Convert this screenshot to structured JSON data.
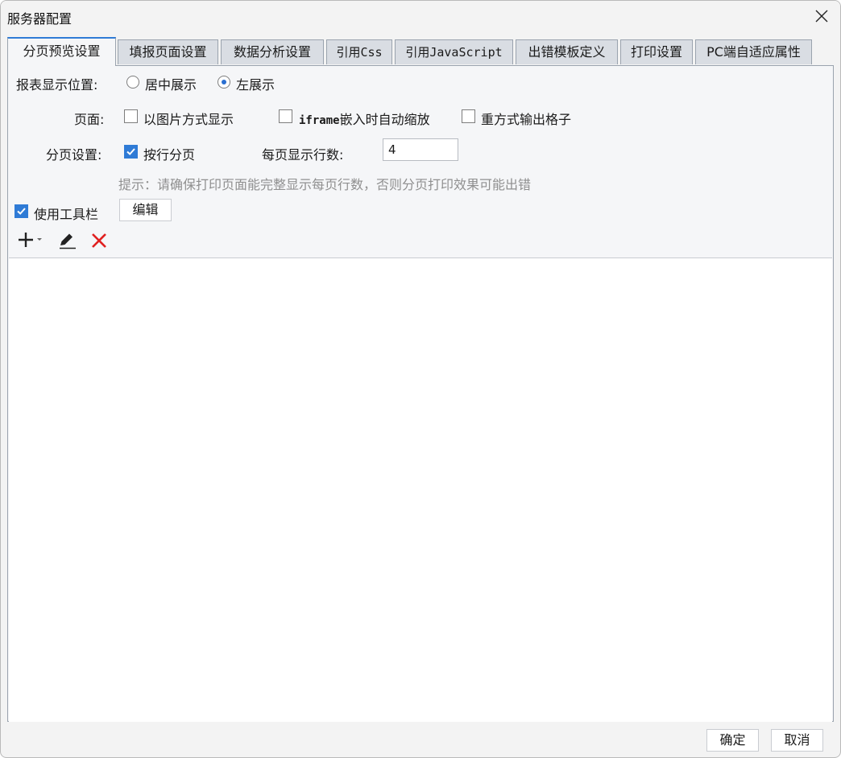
{
  "window": {
    "title": "服务器配置"
  },
  "tabs": [
    {
      "label": "分页预览设置",
      "active": true
    },
    {
      "label": "填报页面设置"
    },
    {
      "label": "数据分析设置"
    },
    {
      "label": "引用Css"
    },
    {
      "label": "引用JavaScript"
    },
    {
      "label": "出错模板定义"
    },
    {
      "label": "打印设置"
    },
    {
      "label": "PC端自适应属性"
    }
  ],
  "report_position": {
    "label": "报表显示位置:",
    "options": [
      {
        "label": "居中展示",
        "checked": false
      },
      {
        "label": "左展示",
        "checked": true
      }
    ]
  },
  "page": {
    "label": "页面:",
    "options": [
      {
        "label": "以图片方式显示",
        "checked": false
      },
      {
        "label_prefix": "iframe",
        "label_suffix": "嵌入时自动缩放",
        "checked": false
      },
      {
        "label": "重方式输出格子",
        "checked": false
      }
    ]
  },
  "pagination": {
    "label": "分页设置:",
    "by_row": {
      "label": "按行分页",
      "checked": true
    },
    "rows_label": "每页显示行数:",
    "rows_value": "4",
    "hint": "提示：请确保打印页面能完整显示每页行数，否则分页打印效果可能出错"
  },
  "toolbar": {
    "use_toolbar": {
      "label": "使用工具栏",
      "checked": true
    },
    "edit_button": "编辑",
    "icons": [
      "add-icon",
      "edit-pencil-icon",
      "delete-icon"
    ]
  },
  "footer": {
    "ok": "确定",
    "cancel": "取消"
  },
  "colors": {
    "accent": "#2f7bd6",
    "delete": "#e02020"
  }
}
